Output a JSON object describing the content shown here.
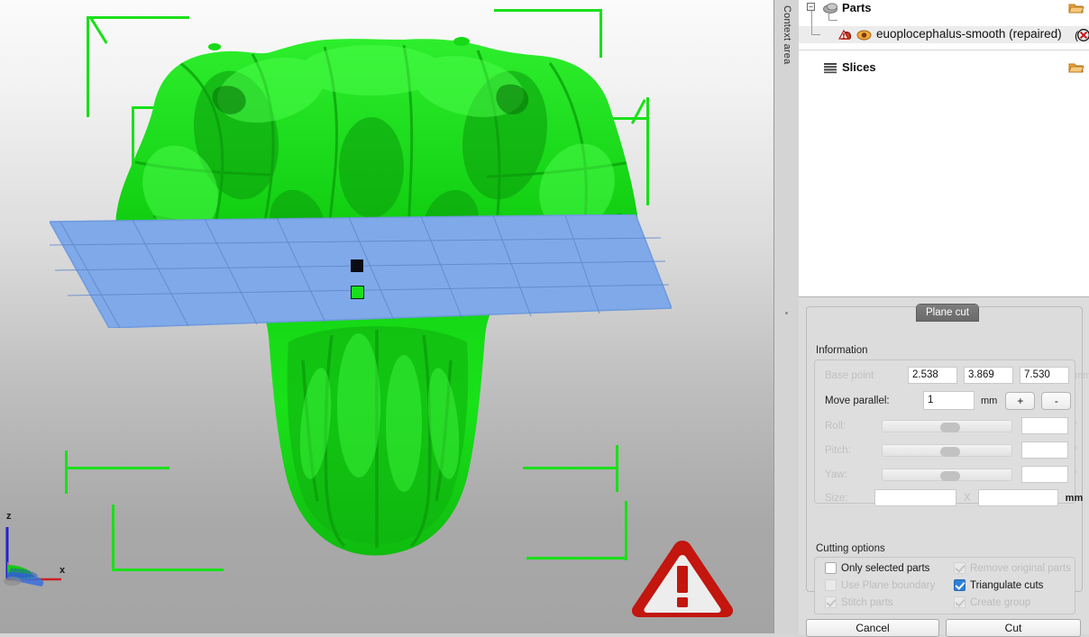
{
  "context_strip": {
    "label": "Context area"
  },
  "tree": {
    "rows": [
      {
        "label": "Parts",
        "icon": "parts-mesh-icon",
        "folder_icon": "open-folder-icon",
        "bold": true,
        "selected": false,
        "indent": 28
      },
      {
        "label": "euoplocephalus-smooth (repaired)",
        "icon": "part-warning-icon",
        "eye_icon": "visibility-eye-icon",
        "trailing_icon": "error-badge-icon",
        "bold": false,
        "selected": true,
        "indent": 52
      },
      {
        "label": "Slices",
        "icon": "slices-stack-icon",
        "folder_icon": "open-folder-icon",
        "bold": true,
        "selected": false,
        "indent": 28
      }
    ]
  },
  "dialog": {
    "tab_label": "Plane cut",
    "information": {
      "title": "Information",
      "base_point": {
        "label": "Base point",
        "x": "2.538",
        "y": "3.869",
        "z": "7.530",
        "unit": "mm",
        "disabled": true
      },
      "move_parallel": {
        "label": "Move parallel:",
        "value": "1",
        "unit": "mm",
        "plus_label": "+",
        "minus_label": "-"
      },
      "roll": {
        "label": "Roll:",
        "value": "",
        "unit": "°",
        "disabled": true
      },
      "pitch": {
        "label": "Pitch:",
        "value": "",
        "unit": "°",
        "disabled": true
      },
      "yaw": {
        "label": "Yaw:",
        "value": "",
        "unit": "°",
        "disabled": true
      },
      "size": {
        "label": "Size:",
        "width": "",
        "height": "",
        "separator": "X",
        "unit": "mm",
        "disabled": true
      }
    },
    "cutting_options": {
      "title": "Cutting options",
      "items": [
        {
          "label": "Only selected parts",
          "checked": false,
          "disabled": false
        },
        {
          "label": "Remove original parts",
          "checked": true,
          "disabled": true
        },
        {
          "label": "Use Plane boundary",
          "checked": false,
          "disabled": true
        },
        {
          "label": "Triangulate cuts",
          "checked": true,
          "disabled": false
        },
        {
          "label": "Stitch parts",
          "checked": true,
          "disabled": true
        },
        {
          "label": "Create group",
          "checked": true,
          "disabled": true
        }
      ]
    },
    "buttons": {
      "cancel": "Cancel",
      "cut": "Cut"
    }
  },
  "viewport": {
    "axis_gizmo": {
      "z_label": "z",
      "x_label": "x"
    },
    "model_color": "#16d916",
    "plane_color": "#7aa8e8",
    "bbox_color": "#19e019",
    "warning_icon": "warning-triangle-icon",
    "handles": {
      "origin": "plane-origin-handle",
      "move": "plane-move-handle"
    }
  }
}
